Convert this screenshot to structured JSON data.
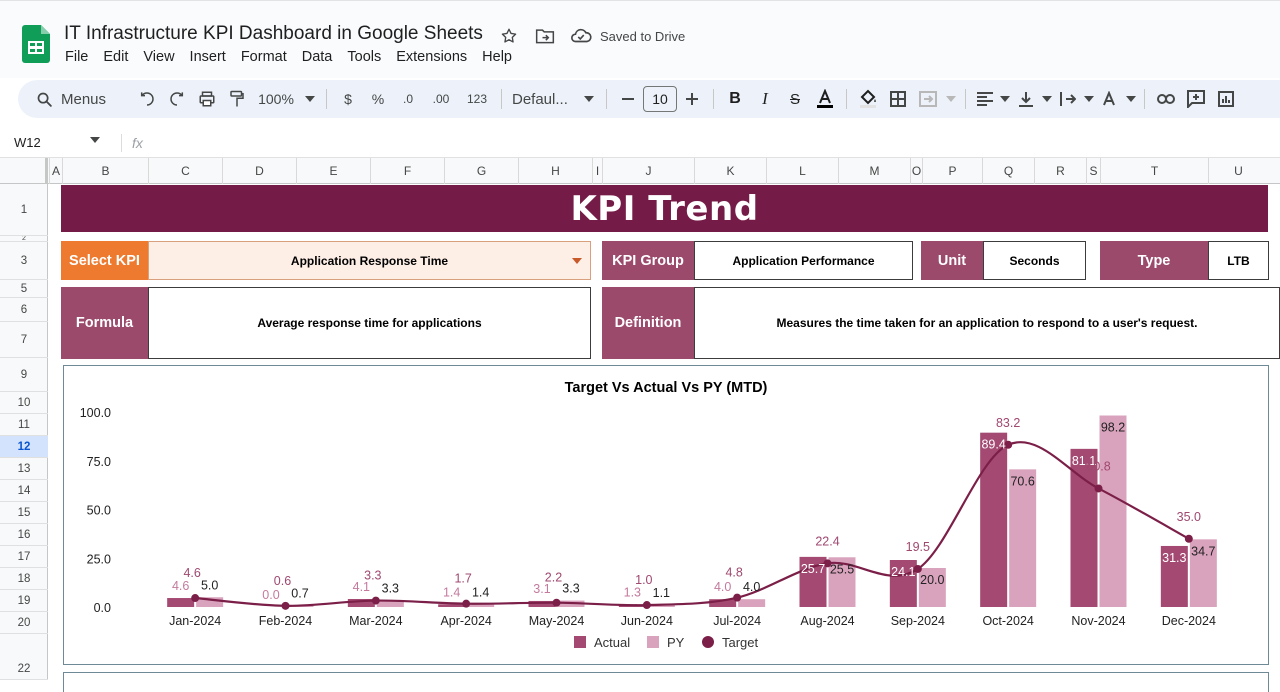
{
  "app": {
    "title": "IT Infrastructure KPI Dashboard in Google Sheets",
    "saved_status": "Saved to Drive",
    "menu": [
      "File",
      "Edit",
      "View",
      "Insert",
      "Format",
      "Data",
      "Tools",
      "Extensions",
      "Help"
    ]
  },
  "toolbar": {
    "search_label": "Menus",
    "zoom": "100%",
    "currency": "$",
    "percent": "%",
    "decrease_decimals": ".0",
    "increase_decimals": ".00",
    "number_format": "123",
    "font": "Defaul...",
    "font_size": "10"
  },
  "formula_bar": {
    "cell_ref": "W12",
    "fx": "fx"
  },
  "columns": [
    "A",
    "B",
    "C",
    "D",
    "E",
    "F",
    "G",
    "H",
    "I",
    "J",
    "K",
    "L",
    "M",
    "O",
    "P",
    "Q",
    "R",
    "S",
    "T",
    "U"
  ],
  "rows": [
    "1",
    "2",
    "3",
    "5",
    "6",
    "7",
    "9",
    "10",
    "11",
    "12",
    "13",
    "14",
    "15",
    "16",
    "17",
    "18",
    "19",
    "20",
    "22"
  ],
  "selected_row": "12",
  "dashboard": {
    "banner": "KPI Trend",
    "select_kpi_label": "Select KPI",
    "select_kpi_value": "Application Response Time",
    "kpi_group_label": "KPI Group",
    "kpi_group_value": "Application Performance",
    "unit_label": "Unit",
    "unit_value": "Seconds",
    "type_label": "Type",
    "type_value": "LTB",
    "formula_label": "Formula",
    "formula_value": "Average response time for applications",
    "definition_label": "Definition",
    "definition_value": "Measures the time taken for an application to respond to a user's request."
  },
  "colors": {
    "banner": "#751b47",
    "label_bg": "#9c4a6c",
    "select_kpi_bg": "#ee7a30",
    "select_kpi_value_bg": "#fdeee6",
    "actual": "#a44a72",
    "py": "#d9a3bd",
    "target": "#7b1f48"
  },
  "chart_data": {
    "type": "bar",
    "title": "Target Vs Actual Vs PY (MTD)",
    "categories": [
      "Jan-2024",
      "Feb-2024",
      "Mar-2024",
      "Apr-2024",
      "May-2024",
      "Jun-2024",
      "Jul-2024",
      "Aug-2024",
      "Sep-2024",
      "Oct-2024",
      "Nov-2024",
      "Dec-2024"
    ],
    "series": [
      {
        "name": "Actual",
        "type": "bar",
        "values": [
          4.6,
          0.0,
          4.1,
          1.4,
          3.1,
          1.3,
          4.0,
          25.7,
          24.1,
          89.4,
          81.1,
          31.3
        ]
      },
      {
        "name": "PY",
        "type": "bar",
        "values": [
          5.0,
          0.7,
          3.3,
          1.4,
          3.3,
          1.1,
          4.0,
          25.5,
          20.0,
          70.6,
          98.2,
          34.7
        ]
      },
      {
        "name": "Target",
        "type": "line",
        "values": [
          4.6,
          0.6,
          3.3,
          1.7,
          2.2,
          1.0,
          4.8,
          22.4,
          19.5,
          83.2,
          60.8,
          35.0
        ]
      }
    ],
    "y_ticks": [
      "100.0",
      "75.0",
      "50.0",
      "25.0",
      "0.0"
    ],
    "ylim": [
      0,
      100
    ],
    "legend_position": "bottom"
  }
}
